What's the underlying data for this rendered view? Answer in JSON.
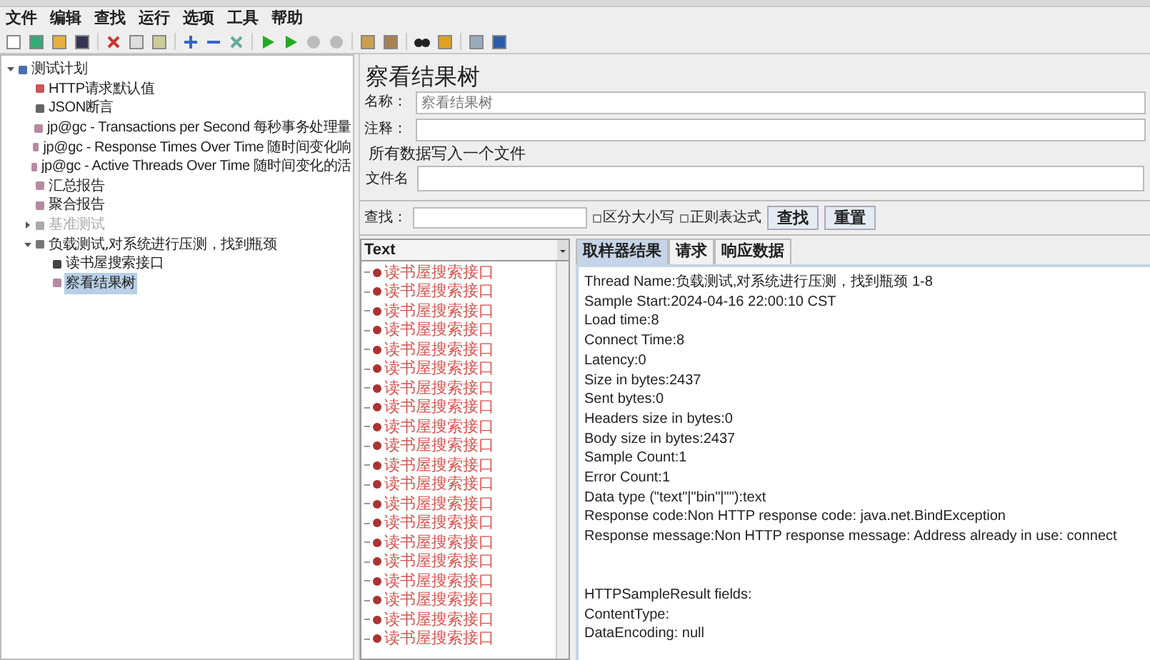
{
  "menu": [
    "文件",
    "编辑",
    "查找",
    "运行",
    "选项",
    "工具",
    "帮助"
  ],
  "tree": [
    {
      "label": "测试计划",
      "kind": "plan",
      "expanded": true,
      "disabled": false,
      "selected": false,
      "children": [
        {
          "label": "HTTP请求默认值",
          "kind": "config",
          "disabled": false,
          "selected": false
        },
        {
          "label": "JSON断言",
          "kind": "assertion",
          "disabled": false,
          "selected": false
        },
        {
          "label": "jp@gc - Transactions per Second 每秒事务处理量",
          "kind": "listener",
          "disabled": false,
          "selected": false
        },
        {
          "label": "jp@gc - Response Times Over Time 随时间变化响",
          "kind": "listener",
          "disabled": false,
          "selected": false
        },
        {
          "label": "jp@gc - Active Threads Over Time 随时间变化的活",
          "kind": "listener",
          "disabled": false,
          "selected": false
        },
        {
          "label": "汇总报告",
          "kind": "listener",
          "disabled": false,
          "selected": false
        },
        {
          "label": "聚合报告",
          "kind": "listener",
          "disabled": false,
          "selected": false
        },
        {
          "label": "基准测试",
          "kind": "group",
          "expanded": false,
          "disabled": true,
          "selected": false
        },
        {
          "label": "负载测试,对系统进行压测，找到瓶颈",
          "kind": "group",
          "expanded": true,
          "disabled": false,
          "selected": false,
          "children": [
            {
              "label": "读书屋搜索接口",
              "kind": "sampler",
              "disabled": false,
              "selected": false
            },
            {
              "label": "察看结果树",
              "kind": "listener",
              "disabled": false,
              "selected": true
            }
          ]
        }
      ]
    }
  ],
  "panel": {
    "title": "察看结果树",
    "name_label": "名称：",
    "name_value": "察看结果树",
    "comment_label": "注释：",
    "file_section": "所有数据写入一个文件",
    "file_label": "文件名"
  },
  "search": {
    "label": "查找：",
    "case_label": "区分大小写",
    "case_checked": false,
    "regex_label": "正则表达式",
    "regex_checked": false,
    "find_button": "查找",
    "reset_button": "重置"
  },
  "renderer": "Text",
  "results": [
    {
      "label": "读书屋搜索接口",
      "error": true
    },
    {
      "label": "读书屋搜索接口",
      "error": true
    },
    {
      "label": "读书屋搜索接口",
      "error": true
    },
    {
      "label": "读书屋搜索接口",
      "error": true
    },
    {
      "label": "读书屋搜索接口",
      "error": true
    },
    {
      "label": "读书屋搜索接口",
      "error": true
    },
    {
      "label": "读书屋搜索接口",
      "error": true
    },
    {
      "label": "读书屋搜索接口",
      "error": true
    },
    {
      "label": "读书屋搜索接口",
      "error": true
    },
    {
      "label": "读书屋搜索接口",
      "error": true
    },
    {
      "label": "读书屋搜索接口",
      "error": true
    },
    {
      "label": "读书屋搜索接口",
      "error": true
    },
    {
      "label": "读书屋搜索接口",
      "error": true
    },
    {
      "label": "读书屋搜索接口",
      "error": true
    },
    {
      "label": "读书屋搜索接口",
      "error": true
    },
    {
      "label": "读书屋搜索接口",
      "error": true
    },
    {
      "label": "读书屋搜索接口",
      "error": true
    },
    {
      "label": "读书屋搜索接口",
      "error": true
    },
    {
      "label": "读书屋搜索接口",
      "error": true
    },
    {
      "label": "读书屋搜索接口",
      "error": true
    }
  ],
  "detail_tabs": [
    {
      "label": "取样器结果",
      "selected": true
    },
    {
      "label": "请求",
      "selected": false
    },
    {
      "label": "响应数据",
      "selected": false
    }
  ],
  "detail_lines": [
    "Thread Name:负载测试,对系统进行压测，找到瓶颈 1-8",
    "Sample Start:2024-04-16 22:00:10 CST",
    "Load time:8",
    "Connect Time:8",
    "Latency:0",
    "Size in bytes:2437",
    "Sent bytes:0",
    "Headers size in bytes:0",
    "Body size in bytes:2437",
    "Sample Count:1",
    "Error Count:1",
    "Data type (\"text\"|\"bin\"|\"\"):text",
    "Response code:Non HTTP response code: java.net.BindException",
    "Response message:Non HTTP response message: Address already in use: connect"
  ],
  "detail_fields": [
    "HTTPSampleResult fields:",
    "ContentType:",
    "DataEncoding: null"
  ]
}
